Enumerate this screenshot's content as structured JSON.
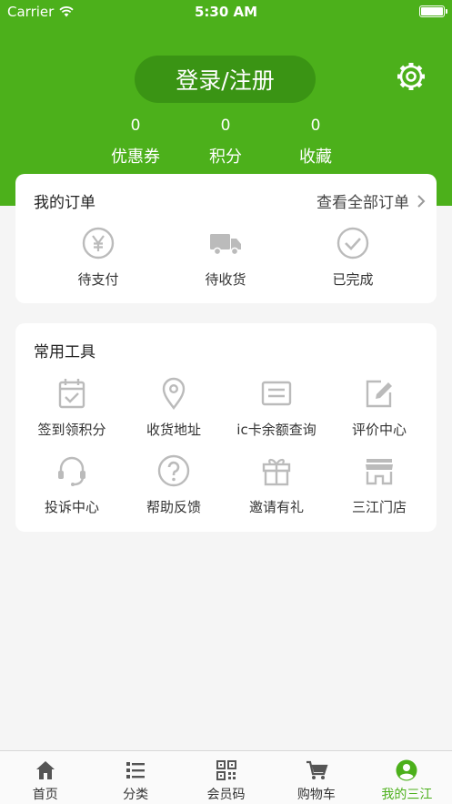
{
  "status_bar": {
    "carrier": "Carrier",
    "time": "5:30 AM"
  },
  "header": {
    "login_label": "登录/注册",
    "settings_icon": "gear-icon",
    "stats": [
      {
        "value": "0",
        "label": "优惠券"
      },
      {
        "value": "0",
        "label": "积分"
      },
      {
        "value": "0",
        "label": "收藏"
      }
    ]
  },
  "orders": {
    "title": "我的订单",
    "view_all": "查看全部订单",
    "items": [
      {
        "label": "待支付",
        "icon": "yen-circle-icon"
      },
      {
        "label": "待收货",
        "icon": "truck-icon"
      },
      {
        "label": "已完成",
        "icon": "check-circle-icon"
      }
    ]
  },
  "tools": {
    "title": "常用工具",
    "items": [
      {
        "label": "签到领积分",
        "icon": "calendar-check-icon"
      },
      {
        "label": "收货地址",
        "icon": "location-pin-icon"
      },
      {
        "label": "ic卡余额查询",
        "icon": "card-icon"
      },
      {
        "label": "评价中心",
        "icon": "edit-icon"
      },
      {
        "label": "投诉中心",
        "icon": "headset-icon"
      },
      {
        "label": "帮助反馈",
        "icon": "help-icon"
      },
      {
        "label": "邀请有礼",
        "icon": "gift-icon"
      },
      {
        "label": "三江门店",
        "icon": "store-icon"
      }
    ]
  },
  "tab_bar": {
    "active_color": "#4cb01b",
    "tabs": [
      {
        "label": "首页",
        "icon": "home-icon"
      },
      {
        "label": "分类",
        "icon": "list-icon"
      },
      {
        "label": "会员码",
        "icon": "qr-code-icon"
      },
      {
        "label": "购物车",
        "icon": "cart-icon"
      },
      {
        "label": "我的三江",
        "icon": "user-icon",
        "active": true
      }
    ]
  },
  "colors": {
    "brand": "#4cb01b",
    "login_button": "#3a9414",
    "icon_gray": "#bbbbbb"
  }
}
